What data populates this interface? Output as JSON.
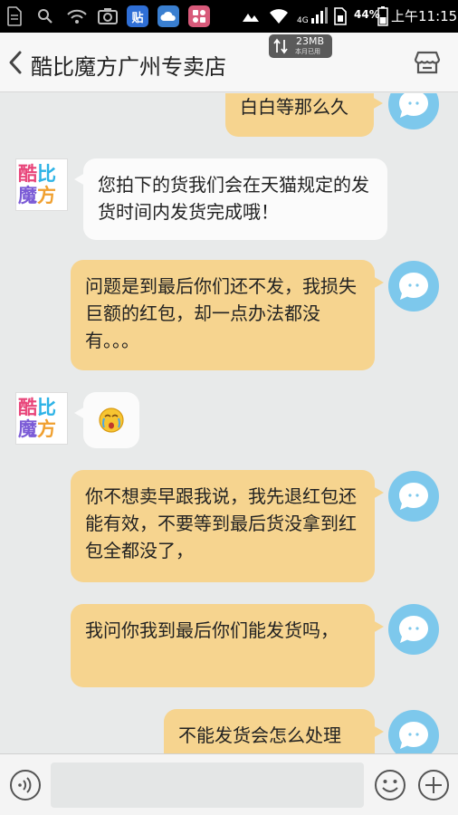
{
  "status_bar": {
    "apps": [
      {
        "icon": "document-icon",
        "label": ""
      },
      {
        "icon": "search-icon",
        "label": ""
      },
      {
        "icon": "wifi-cloud-icon",
        "label": ""
      },
      {
        "icon": "camera-icon",
        "label": ""
      },
      {
        "icon": "tieba-icon",
        "label": "贴",
        "color": "#2f6fd6"
      },
      {
        "icon": "weather-cloud-icon",
        "label": "",
        "color": "#3a7fd0"
      },
      {
        "icon": "app-store-icon",
        "label": "",
        "color": "#d85a7a"
      }
    ],
    "network": "4G",
    "battery": "44%",
    "time": "上午11:15"
  },
  "header": {
    "title": "酷比魔方广州专卖店",
    "data_usage": "23MB",
    "data_usage_caption": "本月已用"
  },
  "shop_avatar": {
    "line1": [
      "酷",
      "比"
    ],
    "line2": [
      "魔",
      "方"
    ]
  },
  "messages": [
    {
      "from": "me",
      "text": "白白等那么久"
    },
    {
      "from": "them",
      "text": "您拍下的货我们会在天猫规定的发货时间内发货完成哦！"
    },
    {
      "from": "me",
      "text": "问题是到最后你们还不发，我损失巨额的红包，却一点办法都没有。。。"
    },
    {
      "from": "them",
      "text": "",
      "sticker": "crying-emoji"
    },
    {
      "from": "me",
      "text": "你不想卖早跟我说，我先退红包还能有效，不要等到最后货没拿到红包全都没了，"
    },
    {
      "from": "me",
      "text": "我问你我到最后你们能发货吗，"
    },
    {
      "from": "me",
      "text": "不能发货会怎么处理"
    }
  ],
  "input": {
    "value": "",
    "placeholder": ""
  },
  "colors": {
    "my_bubble": "#f6d48f",
    "their_bubble": "#fbfbfb",
    "my_avatar": "#7dc8ec",
    "background": "#e8eaea"
  }
}
